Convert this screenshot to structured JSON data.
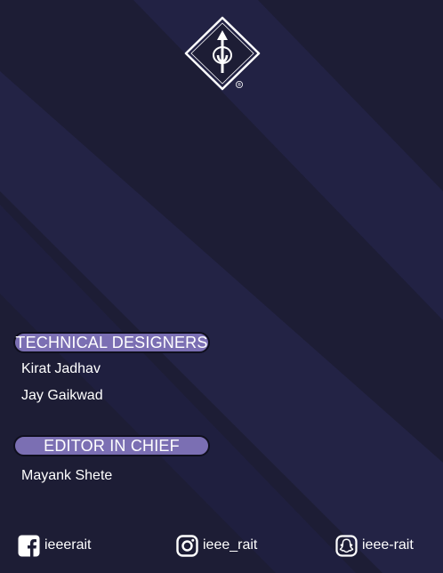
{
  "logo": {
    "icon": "ieee-diamond-logo-icon",
    "registered_mark": "®"
  },
  "sections": [
    {
      "heading": "TECHNICAL DESIGNERS",
      "names": [
        "Kirat Jadhav",
        "Jay Gaikwad"
      ]
    },
    {
      "heading": "EDITOR IN CHIEF",
      "names": [
        "Mayank Shete"
      ]
    }
  ],
  "socials": [
    {
      "icon": "facebook-icon",
      "handle": "ieeerait"
    },
    {
      "icon": "instagram-icon",
      "handle": "ieee_rait"
    },
    {
      "icon": "snapchat-icon",
      "handle": "ieee-rait"
    }
  ],
  "colors": {
    "background": "#1d1d35",
    "stripe": "#26264a",
    "pill": "#7b6fb3",
    "text": "#ffffff"
  }
}
